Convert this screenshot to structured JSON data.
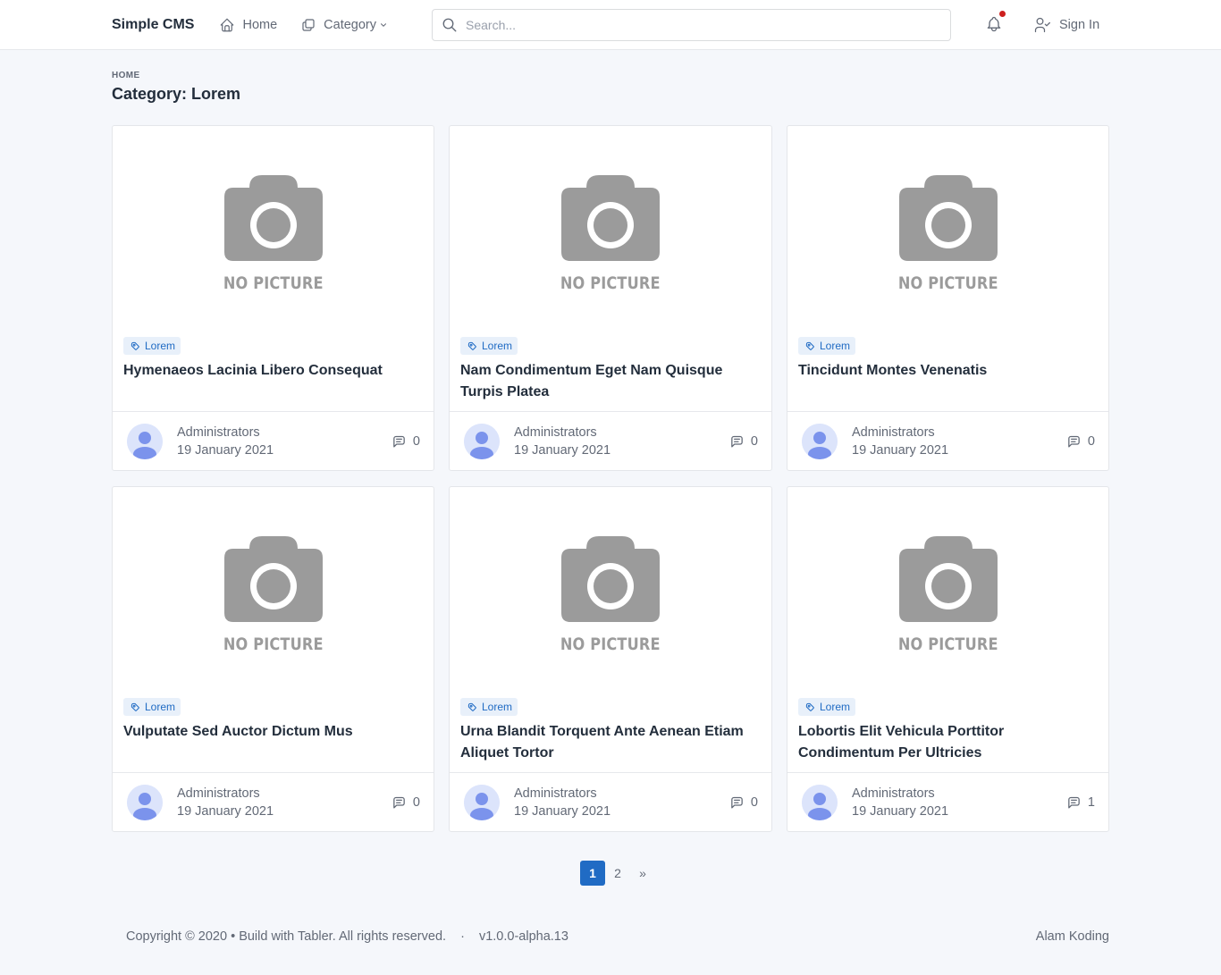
{
  "header": {
    "brand": "Simple CMS",
    "nav": [
      {
        "label": "Home",
        "icon": "home-icon"
      },
      {
        "label": "Category",
        "icon": "category-icon"
      }
    ],
    "search": {
      "placeholder": "Search...",
      "value": ""
    },
    "notification_dot_color": "#cd201f",
    "signin_label": "Sign In"
  },
  "page": {
    "pretitle": "HOME",
    "title": "Category: Lorem"
  },
  "posts": [
    {
      "tag": "Lorem",
      "title": "Hymenaeos Lacinia Libero Consequat",
      "author": "Administrators",
      "date": "19 January 2021",
      "comments": "0",
      "image_text": "NO PICTURE"
    },
    {
      "tag": "Lorem",
      "title": "Nam Condimentum Eget Nam Quisque Turpis Platea",
      "author": "Administrators",
      "date": "19 January 2021",
      "comments": "0",
      "image_text": "NO PICTURE"
    },
    {
      "tag": "Lorem",
      "title": "Tincidunt Montes Venenatis",
      "author": "Administrators",
      "date": "19 January 2021",
      "comments": "0",
      "image_text": "NO PICTURE"
    },
    {
      "tag": "Lorem",
      "title": "Vulputate Sed Auctor Dictum Mus",
      "author": "Administrators",
      "date": "19 January 2021",
      "comments": "0",
      "image_text": "NO PICTURE"
    },
    {
      "tag": "Lorem",
      "title": "Urna Blandit Torquent Ante Aenean Etiam Aliquet Tortor",
      "author": "Administrators",
      "date": "19 January 2021",
      "comments": "0",
      "image_text": "NO PICTURE"
    },
    {
      "tag": "Lorem",
      "title": "Lobortis Elit Vehicula Porttitor Condimentum Per Ultricies",
      "author": "Administrators",
      "date": "19 January 2021",
      "comments": "1",
      "image_text": "NO PICTURE"
    }
  ],
  "pagination": {
    "pages": [
      "1",
      "2"
    ],
    "active": "1",
    "next": "»"
  },
  "footer": {
    "copyright": "Copyright © 2020 • Build with Tabler. All rights reserved.",
    "separator": "·",
    "version": "v1.0.0-alpha.13",
    "author": "Alam Koding"
  },
  "colors": {
    "accent": "#206bc4",
    "background": "#f5f7fb",
    "tag_bg": "#e8f0fa",
    "placeholder_gray": "#9b9b9b"
  }
}
